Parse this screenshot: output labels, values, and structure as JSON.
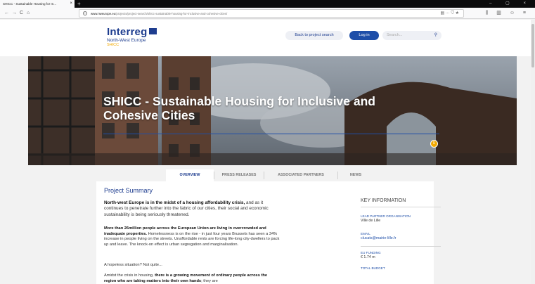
{
  "browser": {
    "tab_title": "SHICC - Sustainable Housing for In...",
    "tab_close": "×",
    "new_tab": "+",
    "window_controls": "– ▢ ×",
    "nav_back": "←",
    "nav_forward": "→",
    "nav_reload": "C",
    "nav_home": "⌂",
    "url_host": "www.nweurope.eu",
    "url_path": "/projects/project-search/shicc-sustainable-housing-for-inclusive-and-cohesive-cities/",
    "url_actions": "▤   ··· ⛉ ★",
    "toolbar_icons": "⫼ ▥ ☺ ≡"
  },
  "site": {
    "logo_main": "Interreg",
    "logo_sub": "North-West Europe",
    "logo_tag": "SHICC",
    "back_button": "Back to project search",
    "login_button": "Log in",
    "search_placeholder": "Search..."
  },
  "hero": {
    "title": "SHICC - Sustainable Housing for Inclusive and Cohesive Cities",
    "badge": "U"
  },
  "tabs": [
    "OVERVIEW",
    "PRESS RELEASES",
    "ASSOCIATED PARTNERS",
    "NEWS"
  ],
  "summary": {
    "heading": "Project Summary",
    "p1_bold": "North-west Europe is in the midst of a housing affordability crisis,",
    "p1_rest": " and as it continues to penetrate further into the fabric of our cities, their social and economic sustainability is being seriously threatened.",
    "p2_bold": "More than 26million people across the European Union are living in overcrowded and inadequate properties.",
    "p2_rest": " Homelessness is on the rise - in just four years Brussels has seen a 34% increase in people living on the streets. Unaffordable rents are forcing life-long city-dwellers to pack up and leave. The knock-on effect is urban segregation and marginalisation.",
    "p3": "A hopeless situation? Not quite...",
    "p4_start": "Amidst the crisis in housing, ",
    "p4_bold": "there is a growing movement of ordinary people across the region who are taking matters into their own hands",
    "p4_rest": "; they are"
  },
  "key_info": {
    "heading": "KEY INFORMATION",
    "lead_label": "LEAD PARTNER ORGANISATION",
    "lead_value": "Ville de Lille",
    "email_label": "EMAIL",
    "email_value": "clucats@mairie-lille.fr",
    "funding_label": "EU FUNDING",
    "funding_value": "€ 1.74 m",
    "budget_label": "TOTAL BUDGET"
  }
}
